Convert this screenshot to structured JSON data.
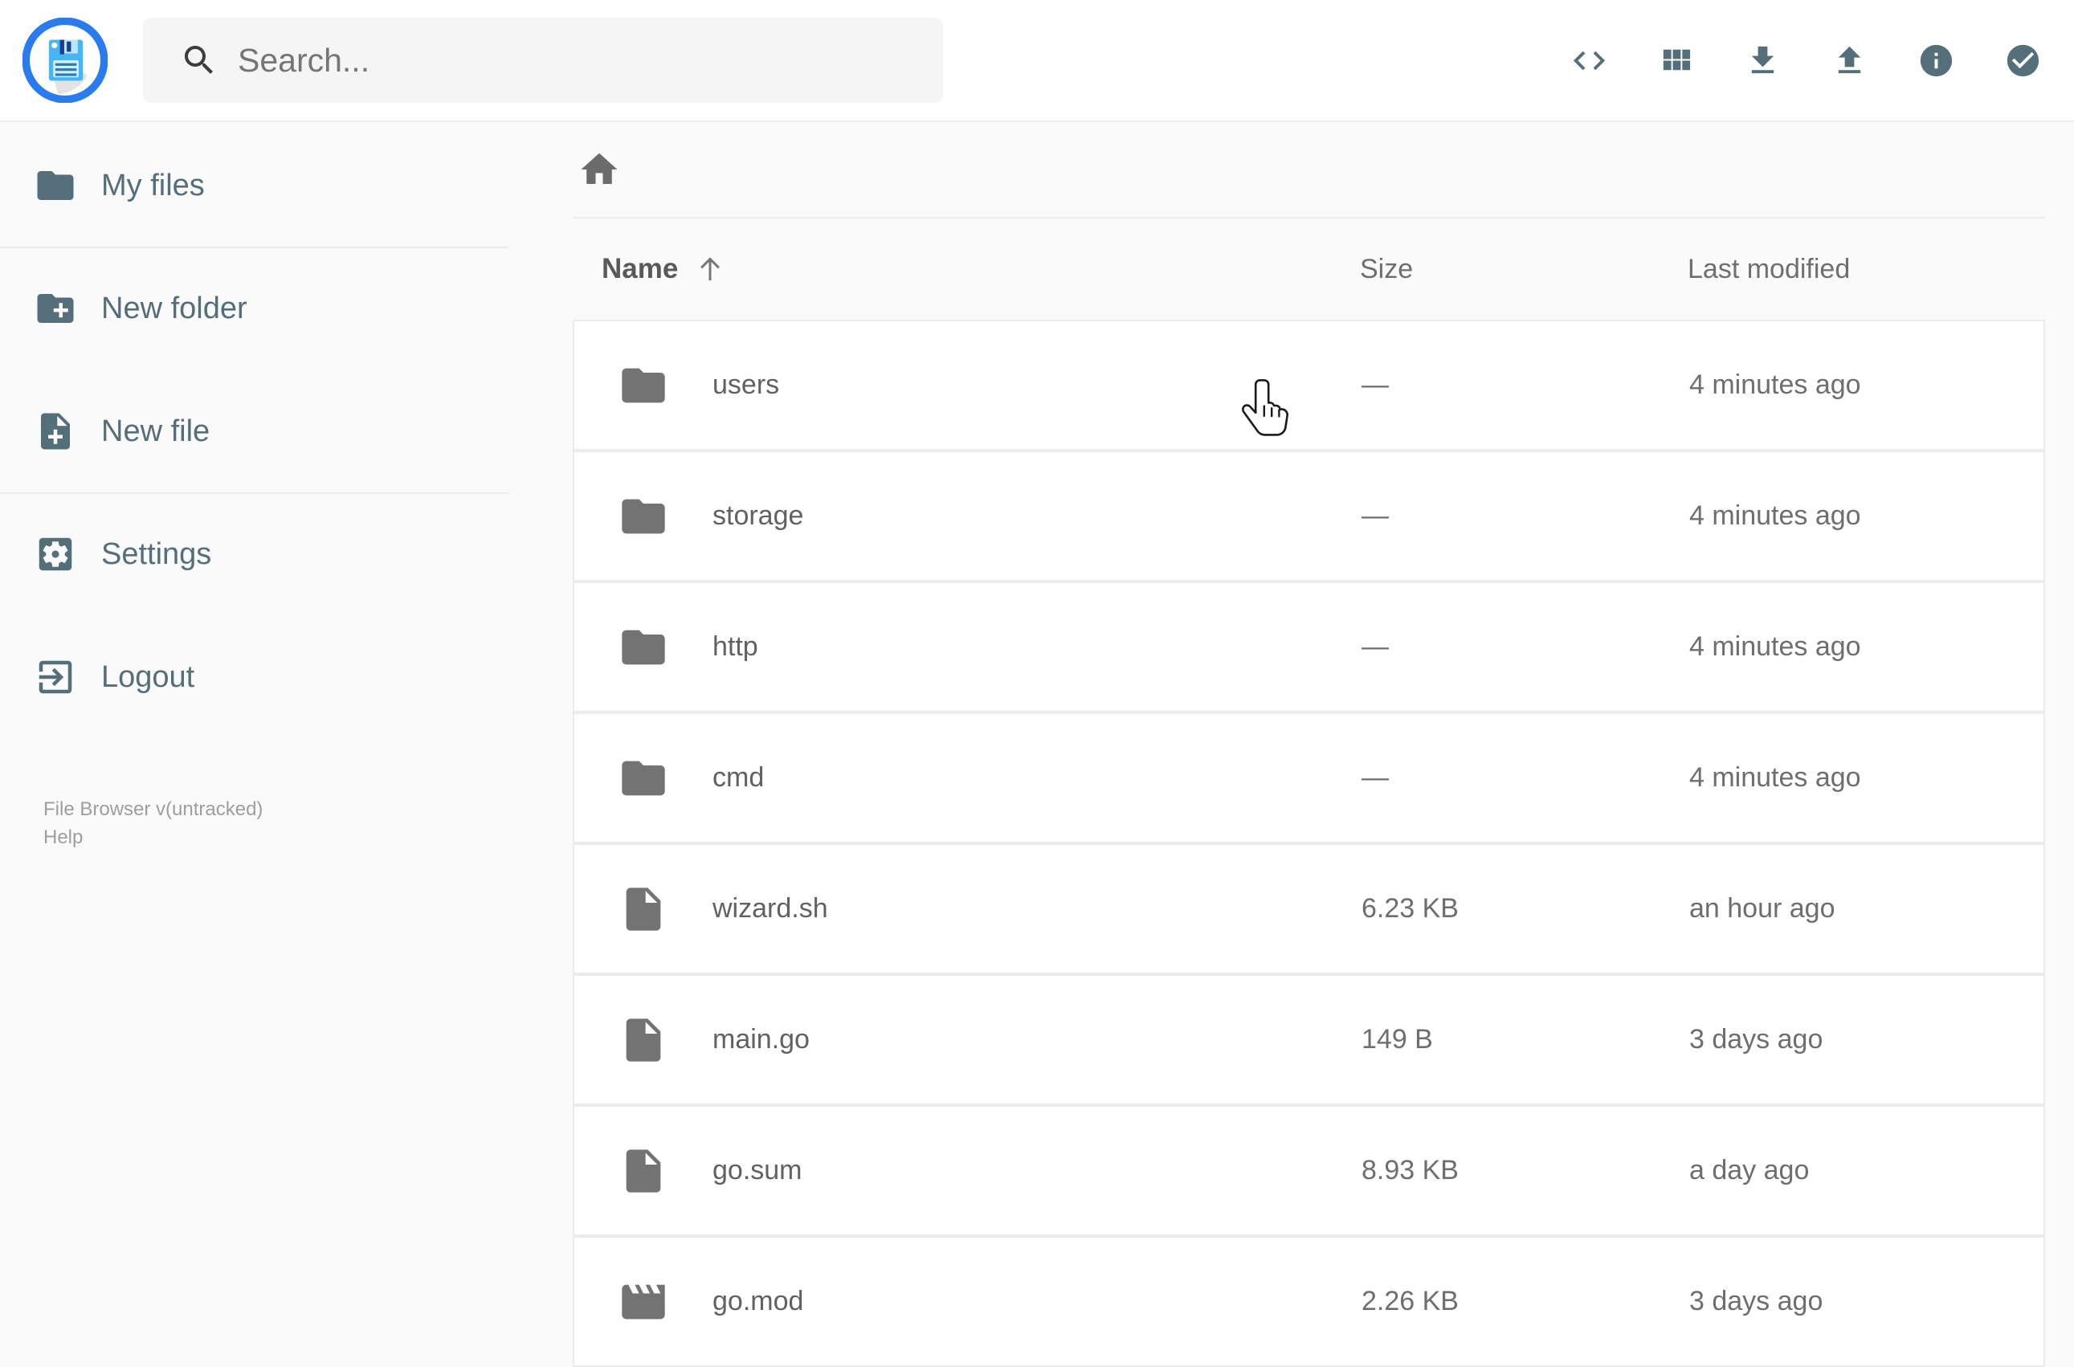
{
  "app": {
    "name": "File Browser",
    "colors": {
      "accent_blue": "#2a7af0",
      "slate": "#546e7a",
      "page_bg": "#fafafa",
      "row_border": "#ececec"
    }
  },
  "header": {
    "logo_icon": "floppy-disk-logo-icon",
    "search_placeholder": "Search...",
    "search_icon": "search-icon",
    "toolbar_icons": [
      "code-icon",
      "grid-view-icon",
      "download-icon",
      "upload-icon",
      "info-icon",
      "select-check-icon"
    ]
  },
  "sidebar": {
    "items": [
      {
        "label": "My files",
        "icon": "folder-icon"
      },
      {
        "label": "New folder",
        "icon": "new-folder-icon"
      },
      {
        "label": "New file",
        "icon": "new-file-icon"
      },
      {
        "label": "Settings",
        "icon": "settings-icon"
      },
      {
        "label": "Logout",
        "icon": "logout-icon"
      }
    ],
    "footer": {
      "version_text": "File Browser v(untracked)",
      "help_label": "Help"
    }
  },
  "breadcrumb": {
    "home_icon": "home-icon"
  },
  "listing": {
    "columns": {
      "name": "Name",
      "size": "Size",
      "modified": "Last modified"
    },
    "sort": {
      "column": "Name",
      "direction": "ascending",
      "icon": "sort-arrow-up-icon"
    },
    "rows": [
      {
        "name": "users",
        "type": "folder",
        "icon": "folder-icon",
        "size": "—",
        "modified": "4 minutes ago"
      },
      {
        "name": "storage",
        "type": "folder",
        "icon": "folder-icon",
        "size": "—",
        "modified": "4 minutes ago"
      },
      {
        "name": "http",
        "type": "folder",
        "icon": "folder-icon",
        "size": "—",
        "modified": "4 minutes ago"
      },
      {
        "name": "cmd",
        "type": "folder",
        "icon": "folder-icon",
        "size": "—",
        "modified": "4 minutes ago"
      },
      {
        "name": "wizard.sh",
        "type": "file",
        "icon": "file-icon",
        "size": "6.23 KB",
        "modified": "an hour ago"
      },
      {
        "name": "main.go",
        "type": "file",
        "icon": "file-icon",
        "size": "149 B",
        "modified": "3 days ago"
      },
      {
        "name": "go.sum",
        "type": "file",
        "icon": "file-icon",
        "size": "8.93 KB",
        "modified": "a day ago"
      },
      {
        "name": "go.mod",
        "type": "file",
        "icon": "movie-icon",
        "size": "2.26 KB",
        "modified": "3 days ago"
      }
    ]
  },
  "cursor": {
    "type": "hand-pointer",
    "over": "users row"
  }
}
